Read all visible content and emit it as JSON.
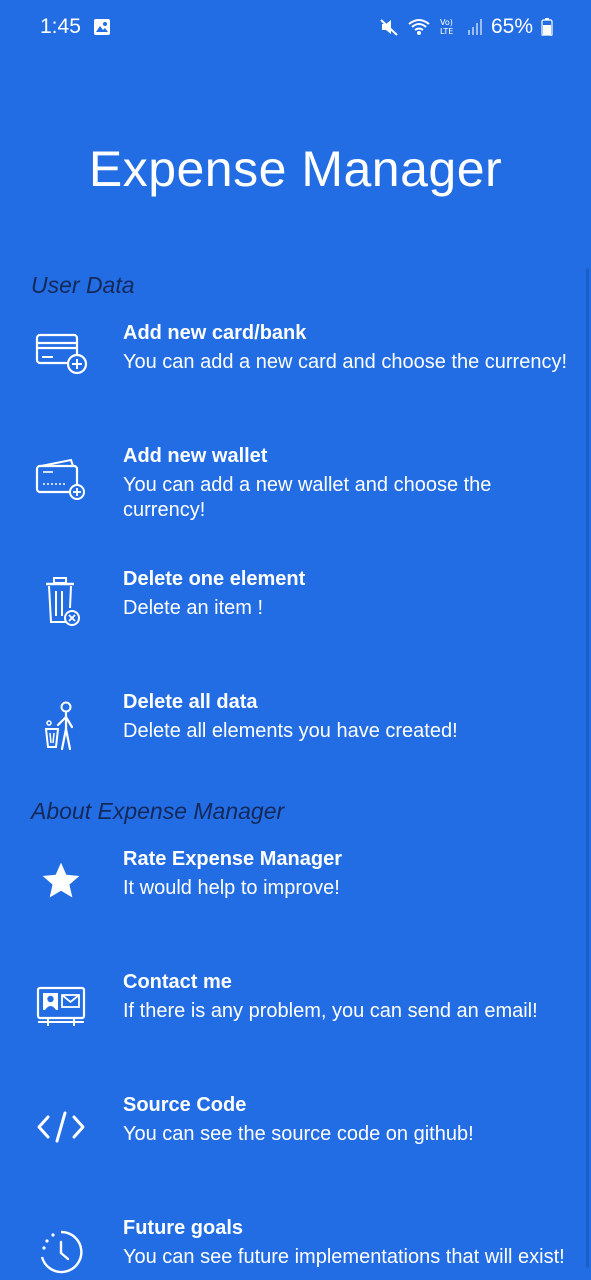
{
  "status_bar": {
    "time": "1:45",
    "battery": "65%"
  },
  "app": {
    "title": "Expense Manager"
  },
  "sections": [
    {
      "header": "User Data",
      "items": [
        {
          "title": "Add new card/bank",
          "description": "You can add a new card and choose the currency!",
          "icon": "card-add-icon"
        },
        {
          "title": "Add new wallet",
          "description": "You can add a new wallet and choose the currency!",
          "icon": "wallet-add-icon"
        },
        {
          "title": "Delete one element",
          "description": "Delete an item !",
          "icon": "trash-delete-icon"
        },
        {
          "title": "Delete all data",
          "description": "Delete all elements you have created!",
          "icon": "person-trash-icon"
        }
      ]
    },
    {
      "header": "About Expense Manager",
      "items": [
        {
          "title": "Rate Expense Manager",
          "description": "It would help to improve!",
          "icon": "star-icon"
        },
        {
          "title": "Contact me",
          "description": "If there is any problem, you can send an email!",
          "icon": "contact-card-icon"
        },
        {
          "title": "Source Code",
          "description": "You can see the source code on github!",
          "icon": "code-icon"
        },
        {
          "title": "Future goals",
          "description": "You can see future implementations that will exist!",
          "icon": "history-clock-icon"
        }
      ]
    }
  ]
}
